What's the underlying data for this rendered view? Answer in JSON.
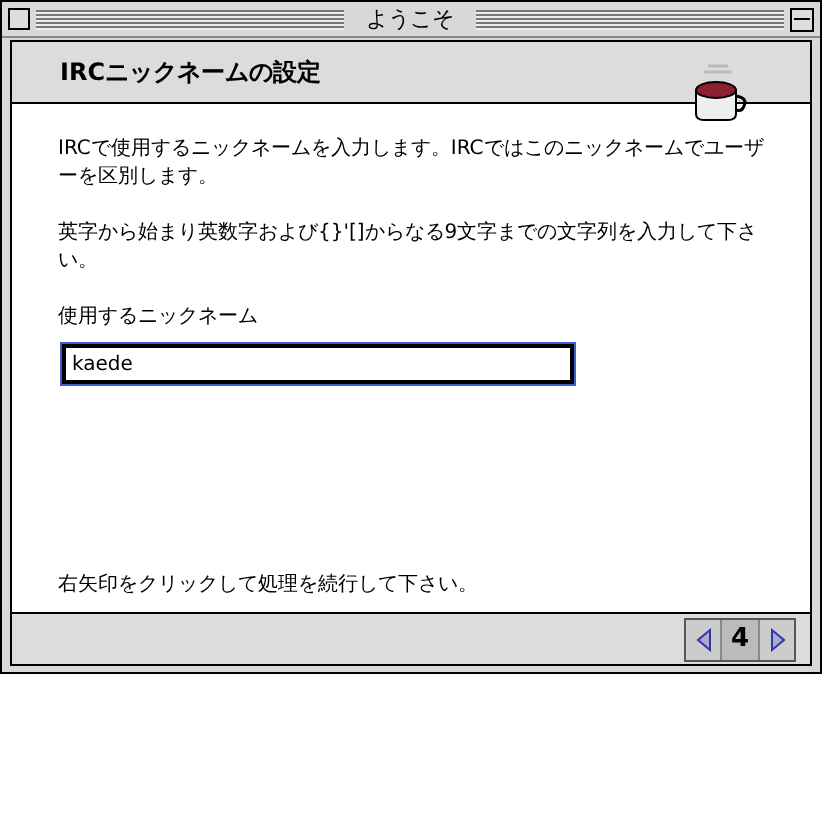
{
  "window": {
    "title": "ようこそ"
  },
  "header": {
    "title": "IRCニックネームの設定"
  },
  "paragraphs": [
    "IRCで使用するニックネームを入力します。IRCではこのニックネームでユーザーを区別します。",
    "英字から始まり英数字および{}'[]からなる9文字までの文字列を入力して下さい。"
  ],
  "nickname_field": {
    "label": "使用するニックネーム",
    "value": "kaede",
    "focused": true
  },
  "footer_text": "右矢印をクリックして処理を続行して下さい。",
  "navigation": {
    "page": "4"
  }
}
